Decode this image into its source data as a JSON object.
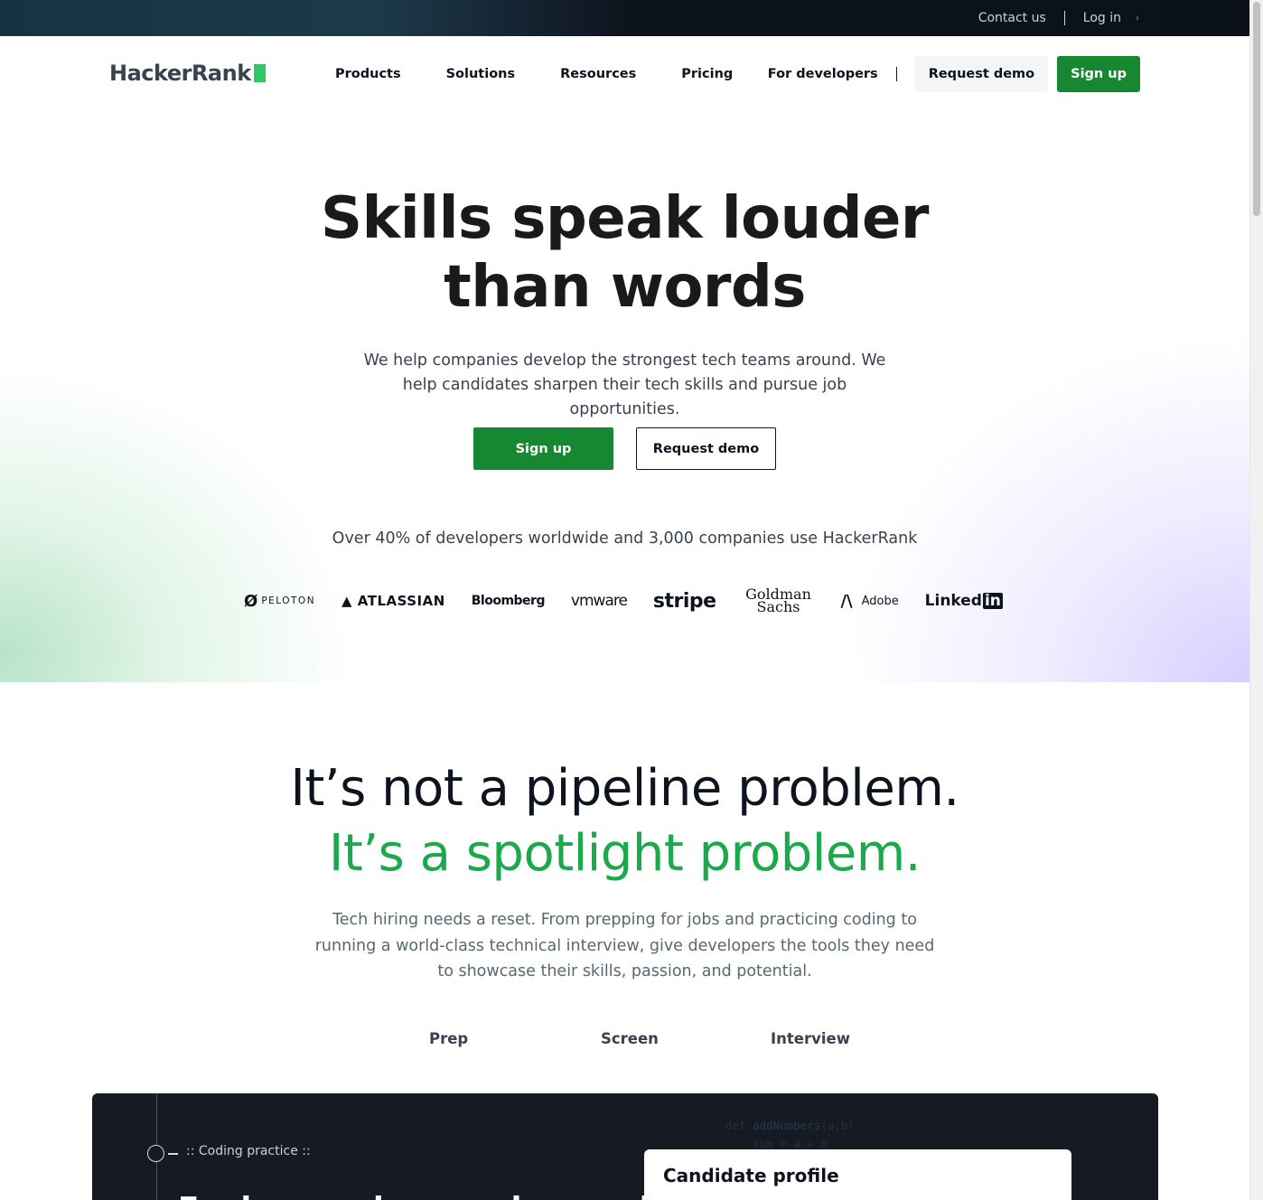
{
  "topbar": {
    "contact": "Contact us",
    "login": "Log in",
    "chevron": "›"
  },
  "nav": {
    "logo": "HackerRank",
    "menu": [
      "Products",
      "Solutions",
      "Resources",
      "Pricing"
    ],
    "for_developers": "For developers",
    "request_demo": "Request demo",
    "sign_up": "Sign up"
  },
  "hero": {
    "title_line1": "Skills speak louder",
    "title_line2": "than words",
    "subtitle": "We help companies develop the strongest tech teams around. We help candidates sharpen their tech skills and pursue job opportunities.",
    "primary_cta": "Sign up",
    "secondary_cta": "Request demo",
    "stat": "Over 40% of developers worldwide and 3,000 companies use HackerRank",
    "logos": {
      "peloton": "PELOTON",
      "atlassian": "ATLASSIAN",
      "bloomberg": "Bloomberg",
      "vmware": "vmware",
      "stripe": "stripe",
      "goldman": "Goldman Sachs",
      "adobe": "Adobe",
      "linkedin_a": "Linked",
      "linkedin_b": "in"
    }
  },
  "pipeline": {
    "line1": "It’s not a pipeline problem.",
    "line2": "It’s a spotlight problem.",
    "subtitle": "Tech hiring needs a reset. From prepping for jobs and practicing coding to running a world-class technical interview, give developers the tools they need to showcase their skills, passion, and potential.",
    "tabs": [
      "Prep",
      "Screen",
      "Interview"
    ]
  },
  "panel": {
    "eyebrow": ":: Coding practice ::",
    "headline": "Explore and expand your skills",
    "code_kw": "def ",
    "code_fn": "addNumbers",
    "code_args": "(a,b):",
    "code_line2": "    sum = a + b",
    "card_title": "Candidate profile"
  },
  "colors": {
    "brand_green": "#188731",
    "accent_green": "#1ba94c",
    "logo_block": "#2ec866",
    "dark": "#0e141e"
  }
}
